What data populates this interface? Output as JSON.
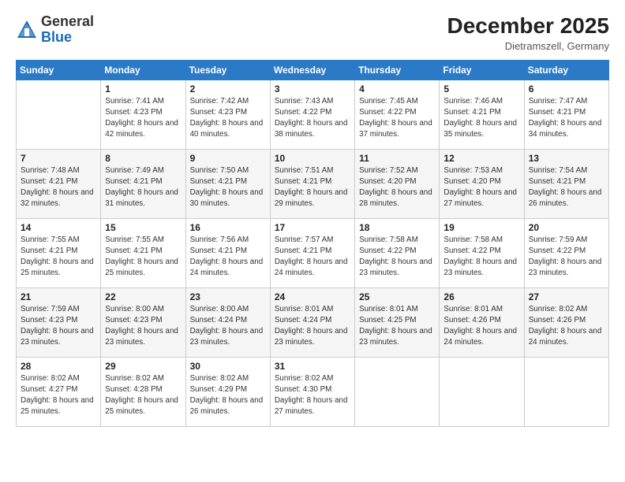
{
  "logo": {
    "general": "General",
    "blue": "Blue"
  },
  "header": {
    "month_year": "December 2025",
    "location": "Dietramszell, Germany"
  },
  "weekdays": [
    "Sunday",
    "Monday",
    "Tuesday",
    "Wednesday",
    "Thursday",
    "Friday",
    "Saturday"
  ],
  "weeks": [
    [
      {
        "day": "",
        "sunrise": "",
        "sunset": "",
        "daylight": ""
      },
      {
        "day": "1",
        "sunrise": "Sunrise: 7:41 AM",
        "sunset": "Sunset: 4:23 PM",
        "daylight": "Daylight: 8 hours and 42 minutes."
      },
      {
        "day": "2",
        "sunrise": "Sunrise: 7:42 AM",
        "sunset": "Sunset: 4:23 PM",
        "daylight": "Daylight: 8 hours and 40 minutes."
      },
      {
        "day": "3",
        "sunrise": "Sunrise: 7:43 AM",
        "sunset": "Sunset: 4:22 PM",
        "daylight": "Daylight: 8 hours and 38 minutes."
      },
      {
        "day": "4",
        "sunrise": "Sunrise: 7:45 AM",
        "sunset": "Sunset: 4:22 PM",
        "daylight": "Daylight: 8 hours and 37 minutes."
      },
      {
        "day": "5",
        "sunrise": "Sunrise: 7:46 AM",
        "sunset": "Sunset: 4:21 PM",
        "daylight": "Daylight: 8 hours and 35 minutes."
      },
      {
        "day": "6",
        "sunrise": "Sunrise: 7:47 AM",
        "sunset": "Sunset: 4:21 PM",
        "daylight": "Daylight: 8 hours and 34 minutes."
      }
    ],
    [
      {
        "day": "7",
        "sunrise": "Sunrise: 7:48 AM",
        "sunset": "Sunset: 4:21 PM",
        "daylight": "Daylight: 8 hours and 32 minutes."
      },
      {
        "day": "8",
        "sunrise": "Sunrise: 7:49 AM",
        "sunset": "Sunset: 4:21 PM",
        "daylight": "Daylight: 8 hours and 31 minutes."
      },
      {
        "day": "9",
        "sunrise": "Sunrise: 7:50 AM",
        "sunset": "Sunset: 4:21 PM",
        "daylight": "Daylight: 8 hours and 30 minutes."
      },
      {
        "day": "10",
        "sunrise": "Sunrise: 7:51 AM",
        "sunset": "Sunset: 4:21 PM",
        "daylight": "Daylight: 8 hours and 29 minutes."
      },
      {
        "day": "11",
        "sunrise": "Sunrise: 7:52 AM",
        "sunset": "Sunset: 4:20 PM",
        "daylight": "Daylight: 8 hours and 28 minutes."
      },
      {
        "day": "12",
        "sunrise": "Sunrise: 7:53 AM",
        "sunset": "Sunset: 4:20 PM",
        "daylight": "Daylight: 8 hours and 27 minutes."
      },
      {
        "day": "13",
        "sunrise": "Sunrise: 7:54 AM",
        "sunset": "Sunset: 4:21 PM",
        "daylight": "Daylight: 8 hours and 26 minutes."
      }
    ],
    [
      {
        "day": "14",
        "sunrise": "Sunrise: 7:55 AM",
        "sunset": "Sunset: 4:21 PM",
        "daylight": "Daylight: 8 hours and 25 minutes."
      },
      {
        "day": "15",
        "sunrise": "Sunrise: 7:55 AM",
        "sunset": "Sunset: 4:21 PM",
        "daylight": "Daylight: 8 hours and 25 minutes."
      },
      {
        "day": "16",
        "sunrise": "Sunrise: 7:56 AM",
        "sunset": "Sunset: 4:21 PM",
        "daylight": "Daylight: 8 hours and 24 minutes."
      },
      {
        "day": "17",
        "sunrise": "Sunrise: 7:57 AM",
        "sunset": "Sunset: 4:21 PM",
        "daylight": "Daylight: 8 hours and 24 minutes."
      },
      {
        "day": "18",
        "sunrise": "Sunrise: 7:58 AM",
        "sunset": "Sunset: 4:22 PM",
        "daylight": "Daylight: 8 hours and 23 minutes."
      },
      {
        "day": "19",
        "sunrise": "Sunrise: 7:58 AM",
        "sunset": "Sunset: 4:22 PM",
        "daylight": "Daylight: 8 hours and 23 minutes."
      },
      {
        "day": "20",
        "sunrise": "Sunrise: 7:59 AM",
        "sunset": "Sunset: 4:22 PM",
        "daylight": "Daylight: 8 hours and 23 minutes."
      }
    ],
    [
      {
        "day": "21",
        "sunrise": "Sunrise: 7:59 AM",
        "sunset": "Sunset: 4:23 PM",
        "daylight": "Daylight: 8 hours and 23 minutes."
      },
      {
        "day": "22",
        "sunrise": "Sunrise: 8:00 AM",
        "sunset": "Sunset: 4:23 PM",
        "daylight": "Daylight: 8 hours and 23 minutes."
      },
      {
        "day": "23",
        "sunrise": "Sunrise: 8:00 AM",
        "sunset": "Sunset: 4:24 PM",
        "daylight": "Daylight: 8 hours and 23 minutes."
      },
      {
        "day": "24",
        "sunrise": "Sunrise: 8:01 AM",
        "sunset": "Sunset: 4:24 PM",
        "daylight": "Daylight: 8 hours and 23 minutes."
      },
      {
        "day": "25",
        "sunrise": "Sunrise: 8:01 AM",
        "sunset": "Sunset: 4:25 PM",
        "daylight": "Daylight: 8 hours and 23 minutes."
      },
      {
        "day": "26",
        "sunrise": "Sunrise: 8:01 AM",
        "sunset": "Sunset: 4:26 PM",
        "daylight": "Daylight: 8 hours and 24 minutes."
      },
      {
        "day": "27",
        "sunrise": "Sunrise: 8:02 AM",
        "sunset": "Sunset: 4:26 PM",
        "daylight": "Daylight: 8 hours and 24 minutes."
      }
    ],
    [
      {
        "day": "28",
        "sunrise": "Sunrise: 8:02 AM",
        "sunset": "Sunset: 4:27 PM",
        "daylight": "Daylight: 8 hours and 25 minutes."
      },
      {
        "day": "29",
        "sunrise": "Sunrise: 8:02 AM",
        "sunset": "Sunset: 4:28 PM",
        "daylight": "Daylight: 8 hours and 25 minutes."
      },
      {
        "day": "30",
        "sunrise": "Sunrise: 8:02 AM",
        "sunset": "Sunset: 4:29 PM",
        "daylight": "Daylight: 8 hours and 26 minutes."
      },
      {
        "day": "31",
        "sunrise": "Sunrise: 8:02 AM",
        "sunset": "Sunset: 4:30 PM",
        "daylight": "Daylight: 8 hours and 27 minutes."
      },
      {
        "day": "",
        "sunrise": "",
        "sunset": "",
        "daylight": ""
      },
      {
        "day": "",
        "sunrise": "",
        "sunset": "",
        "daylight": ""
      },
      {
        "day": "",
        "sunrise": "",
        "sunset": "",
        "daylight": ""
      }
    ]
  ]
}
